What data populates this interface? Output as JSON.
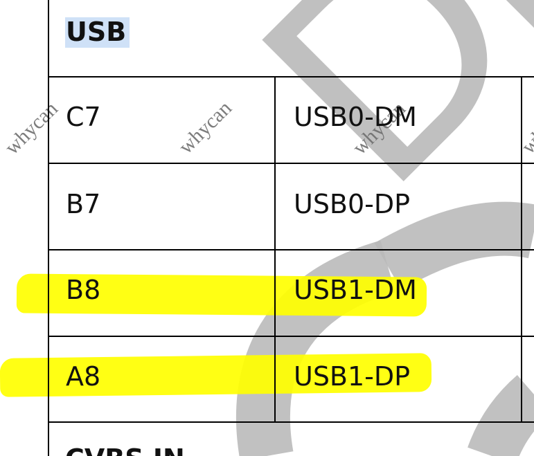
{
  "document": {
    "section_title": "USB",
    "table": {
      "rows": [
        {
          "pin": "C7",
          "signal": "USB0-DM",
          "highlighted": false
        },
        {
          "pin": "B7",
          "signal": "USB0-DP",
          "highlighted": false
        },
        {
          "pin": "B8",
          "signal": "USB1-DM",
          "highlighted": true
        },
        {
          "pin": "A8",
          "signal": "USB1-DP",
          "highlighted": true
        }
      ]
    },
    "next_section_title_partial": "CVBS IN"
  },
  "watermarks": {
    "repeated_text": "whycan",
    "large_text": "Dra"
  },
  "colors": {
    "text": "#111111",
    "table_lines": "#000000",
    "title_highlight": "#cfe1f7",
    "marker_highlight": "#ffff00",
    "watermark_gray": "#b8b8b8"
  }
}
